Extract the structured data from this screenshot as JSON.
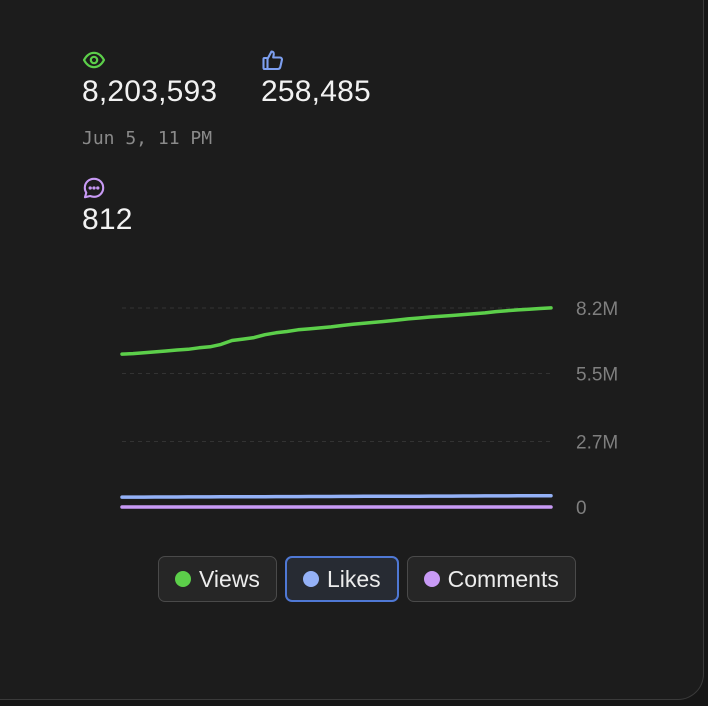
{
  "stats": {
    "views": {
      "value": "8,203,593",
      "icon": "eye-icon",
      "color": "#5ccf4a"
    },
    "likes": {
      "value": "258,485",
      "icon": "thumbs-up-icon",
      "color": "#7d9ff0"
    },
    "comments": {
      "value": "812",
      "icon": "chat-bubble-icon",
      "color": "#c89af5"
    },
    "timestamp": "Jun 5, 11 PM"
  },
  "legend": [
    {
      "label": "Views",
      "color": "#5ccf4a",
      "active": false
    },
    {
      "label": "Likes",
      "color": "#94b1f7",
      "active": true
    },
    {
      "label": "Comments",
      "color": "#c89af5",
      "active": false
    }
  ],
  "chart_data": {
    "type": "line",
    "y_ticks": [
      "8.2M",
      "5.5M",
      "2.7M",
      "0"
    ],
    "y_tick_values": [
      8200000,
      5500000,
      2700000,
      0
    ],
    "ylim": [
      0,
      8200000
    ],
    "y_axis_side": "right",
    "grid": true,
    "legend_placement": "bottom-center",
    "series": [
      {
        "name": "Views",
        "color": "#5ccf4a",
        "values": [
          6300000,
          6320000,
          6360000,
          6390000,
          6430000,
          6470000,
          6500000,
          6560000,
          6600000,
          6700000,
          6860000,
          6920000,
          6980000,
          7100000,
          7180000,
          7230000,
          7300000,
          7340000,
          7380000,
          7420000,
          7480000,
          7530000,
          7570000,
          7610000,
          7650000,
          7700000,
          7750000,
          7790000,
          7830000,
          7860000,
          7890000,
          7930000,
          7960000,
          8000000,
          8050000,
          8090000,
          8120000,
          8150000,
          8180000,
          8203593
        ]
      },
      {
        "name": "Likes",
        "color": "#94b1f7",
        "values": [
          200000,
          201500,
          203000,
          204500,
          206000,
          207500,
          209000,
          210500,
          212000,
          213500,
          215000,
          216500,
          218000,
          219500,
          221000,
          222500,
          224000,
          225500,
          227000,
          228500,
          230000,
          231500,
          233000,
          234500,
          236000,
          237500,
          239000,
          240500,
          242000,
          243500,
          245000,
          246500,
          248000,
          249500,
          251000,
          252500,
          254000,
          255500,
          257000,
          258485
        ]
      },
      {
        "name": "Comments",
        "color": "#c89af5",
        "values": [
          600,
          605,
          611,
          616,
          622,
          627,
          633,
          638,
          644,
          649,
          655,
          660,
          665,
          671,
          676,
          682,
          687,
          693,
          698,
          704,
          709,
          714,
          720,
          725,
          731,
          736,
          742,
          747,
          752,
          758,
          763,
          769,
          774,
          780,
          785,
          790,
          796,
          801,
          807,
          812
        ]
      }
    ]
  }
}
